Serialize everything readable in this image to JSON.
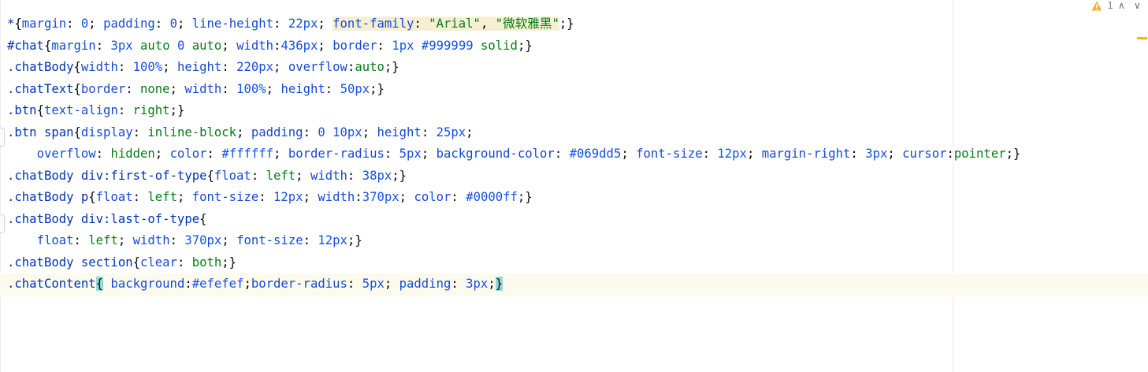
{
  "inspection": {
    "warning_count": "1",
    "up_arrow": "∧",
    "down_arrow": "∨"
  },
  "colors": {
    "selector": "#0033b3",
    "property": "#174ad4",
    "number": "#1750eb",
    "keyword": "#067d17",
    "current_line": "#fcfaed",
    "brace_match": "#93d9d9",
    "warning": "#f2b22a"
  },
  "code": {
    "l1": {
      "t1": "*",
      "t2": "{",
      "t3": "margin",
      "t4": ": ",
      "t5": "0",
      "t6": "; ",
      "t7": "padding",
      "t8": ": ",
      "t9": "0",
      "t10": "; ",
      "t11": "line-height",
      "t12": ": ",
      "t13": "22px",
      "t14": "; ",
      "t15": "font-family",
      "t16": ": ",
      "t17": "\"Arial\"",
      "t18": ", ",
      "t19": "\"微软雅黑\"",
      "t20": ";}"
    },
    "l2": {
      "t1": "#chat",
      "t2": "{",
      "t3": "margin",
      "t4": ": ",
      "t5": "3px",
      "t6": " ",
      "t7": "auto",
      "t8": " ",
      "t9": "0",
      "t10": " ",
      "t11": "auto",
      "t12": "; ",
      "t13": "width",
      "t14": ":",
      "t15": "436px",
      "t16": "; ",
      "t17": "border",
      "t18": ": ",
      "t19": "1px",
      "t20": " ",
      "t21": "#999999",
      "t22": " ",
      "t23": "solid",
      "t24": ";}"
    },
    "l3": {
      "t1": ".chatBody",
      "t2": "{",
      "t3": "width",
      "t4": ": ",
      "t5": "100%",
      "t6": "; ",
      "t7": "height",
      "t8": ": ",
      "t9": "220px",
      "t10": "; ",
      "t11": "overflow",
      "t12": ":",
      "t13": "auto",
      "t14": ";}"
    },
    "l4": {
      "t1": ".chatText",
      "t2": "{",
      "t3": "border",
      "t4": ": ",
      "t5": "none",
      "t6": "; ",
      "t7": "width",
      "t8": ": ",
      "t9": "100%",
      "t10": "; ",
      "t11": "height",
      "t12": ": ",
      "t13": "50px",
      "t14": ";}"
    },
    "l5": {
      "t1": ".btn",
      "t2": "{",
      "t3": "text-align",
      "t4": ": ",
      "t5": "right",
      "t6": ";}"
    },
    "l6": {
      "t1": ".btn span",
      "t2": "{",
      "t3": "display",
      "t4": ": ",
      "t5": "inline-block",
      "t6": "; ",
      "t7": "padding",
      "t8": ": ",
      "t9": "0",
      "t10": " ",
      "t11": "10px",
      "t12": "; ",
      "t13": "height",
      "t14": ": ",
      "t15": "25px",
      "t16": ";"
    },
    "l7": {
      "t0": "    ",
      "t1": "overflow",
      "t2": ": ",
      "t3": "hidden",
      "t4": "; ",
      "t5": "color",
      "t6": ": ",
      "t7": "#ffffff",
      "t8": "; ",
      "t9": "border-radius",
      "t10": ": ",
      "t11": "5px",
      "t12": "; ",
      "t13": "background-color",
      "t14": ": ",
      "t15": "#069dd5",
      "t16": "; ",
      "t17": "font-size",
      "t18": ": ",
      "t19": "12px",
      "t20": "; ",
      "t21": "margin-right",
      "t22": ": ",
      "t23": "3px",
      "t24": "; ",
      "t25": "cursor",
      "t26": ":",
      "t27": "pointer",
      "t28": ";}"
    },
    "l8": {
      "t1": ".chatBody div:first-of-type",
      "t2": "{",
      "t3": "float",
      "t4": ": ",
      "t5": "left",
      "t6": "; ",
      "t7": "width",
      "t8": ": ",
      "t9": "38px",
      "t10": ";}"
    },
    "l9": {
      "t1": ".chatBody p",
      "t2": "{",
      "t3": "float",
      "t4": ": ",
      "t5": "left",
      "t6": "; ",
      "t7": "font-size",
      "t8": ": ",
      "t9": "12px",
      "t10": "; ",
      "t11": "width",
      "t12": ":",
      "t13": "370px",
      "t14": "; ",
      "t15": "color",
      "t16": ": ",
      "t17": "#0000ff",
      "t18": ";}"
    },
    "l10": {
      "t1": ".chatBody div:last-of-type",
      "t2": "{"
    },
    "l11": {
      "t0": "    ",
      "t1": "float",
      "t2": ": ",
      "t3": "left",
      "t4": "; ",
      "t5": "width",
      "t6": ": ",
      "t7": "370px",
      "t8": "; ",
      "t9": "font-size",
      "t10": ": ",
      "t11": "12px",
      "t12": ";}"
    },
    "l12": {
      "t1": ".chatBody section",
      "t2": "{",
      "t3": "clear",
      "t4": ": ",
      "t5": "both",
      "t6": ";}"
    },
    "l13": {
      "t1": ".chatContent",
      "t2": "{",
      "t3": " ",
      "t4": "background",
      "t5": ":",
      "t6": "#efefef",
      "t7": ";",
      "t8": "border-radius",
      "t9": ": ",
      "t10": "5px",
      "t11": "; ",
      "t12": "padding",
      "t13": ": ",
      "t14": "3px",
      "t15": ";",
      "t16": "}"
    }
  }
}
